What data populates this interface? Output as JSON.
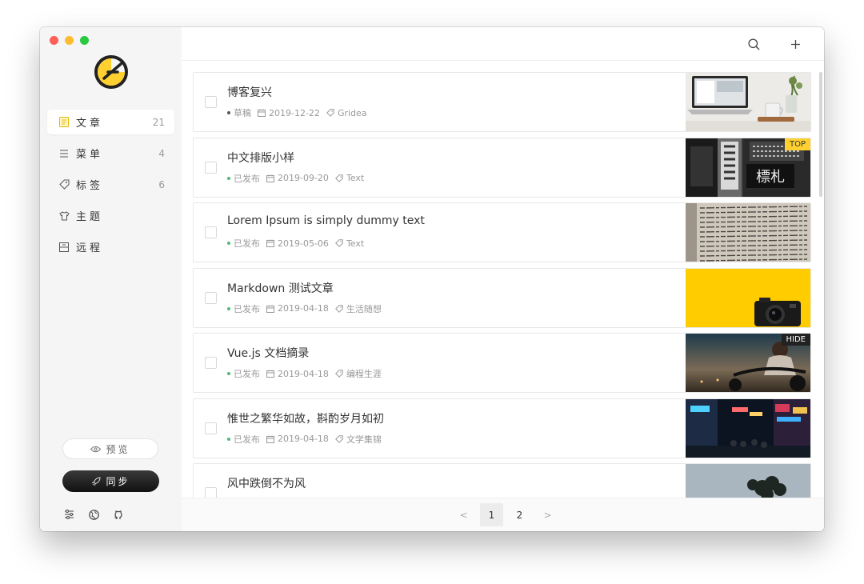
{
  "window": {
    "traffic_lights": [
      {
        "name": "close",
        "color": "#fe5f57"
      },
      {
        "name": "minimize",
        "color": "#febc2e"
      },
      {
        "name": "zoom",
        "color": "#28c840"
      }
    ],
    "logo_icon": "gridea-logo",
    "accent_color": "#ffd02f",
    "published_color": "#4fb978"
  },
  "sidebar": {
    "items": [
      {
        "icon": "article-icon",
        "label": "文章",
        "count": "21",
        "active": true
      },
      {
        "icon": "menu-icon",
        "label": "菜单",
        "count": "4",
        "active": false
      },
      {
        "icon": "tag-icon",
        "label": "标签",
        "count": "6",
        "active": false
      },
      {
        "icon": "theme-shirt-icon",
        "label": "主题",
        "count": "",
        "active": false
      },
      {
        "icon": "remote-icon",
        "label": "远程",
        "count": "",
        "active": false
      }
    ],
    "preview_label": "预览",
    "sync_label": "同步",
    "bottom_tools": [
      "settings-sliders-icon",
      "globe-icon",
      "github-icon"
    ]
  },
  "toolbar": {
    "search_icon": "search-icon",
    "add_icon": "plus-icon"
  },
  "posts": [
    {
      "title": "博客复兴",
      "status": "草稿",
      "status_type": "draft",
      "date": "2019-12-22",
      "tag": "Gridea",
      "badge": "",
      "thumb": "laptop"
    },
    {
      "title": "中文排版小样",
      "status": "已发布",
      "status_type": "published",
      "date": "2019-09-20",
      "tag": "Text",
      "badge": "TOP",
      "thumb": "street-signs"
    },
    {
      "title": "Lorem Ipsum is simply dummy text",
      "status": "已发布",
      "status_type": "published",
      "date": "2019-05-06",
      "tag": "Text",
      "badge": "",
      "thumb": "book-page"
    },
    {
      "title": "Markdown 测试文章",
      "status": "已发布",
      "status_type": "published",
      "date": "2019-04-18",
      "tag": "生活随想",
      "badge": "",
      "thumb": "camera-yellow"
    },
    {
      "title": "Vue.js 文档摘录",
      "status": "已发布",
      "status_type": "published",
      "date": "2019-04-18",
      "tag": "编程生涯",
      "badge": "HIDE",
      "thumb": "motorcycle"
    },
    {
      "title": "惟世之繁华如故，斟酌岁月如初",
      "status": "已发布",
      "status_type": "published",
      "date": "2019-04-18",
      "tag": "文学集锦",
      "badge": "",
      "thumb": "night-city"
    },
    {
      "title": "风中跌倒不为风",
      "status": "",
      "status_type": "",
      "date": "",
      "tag": "",
      "badge": "",
      "thumb": "tree-sky"
    }
  ],
  "pagination": {
    "prev": "<",
    "pages": [
      "1",
      "2"
    ],
    "current": "1",
    "next": ">"
  }
}
